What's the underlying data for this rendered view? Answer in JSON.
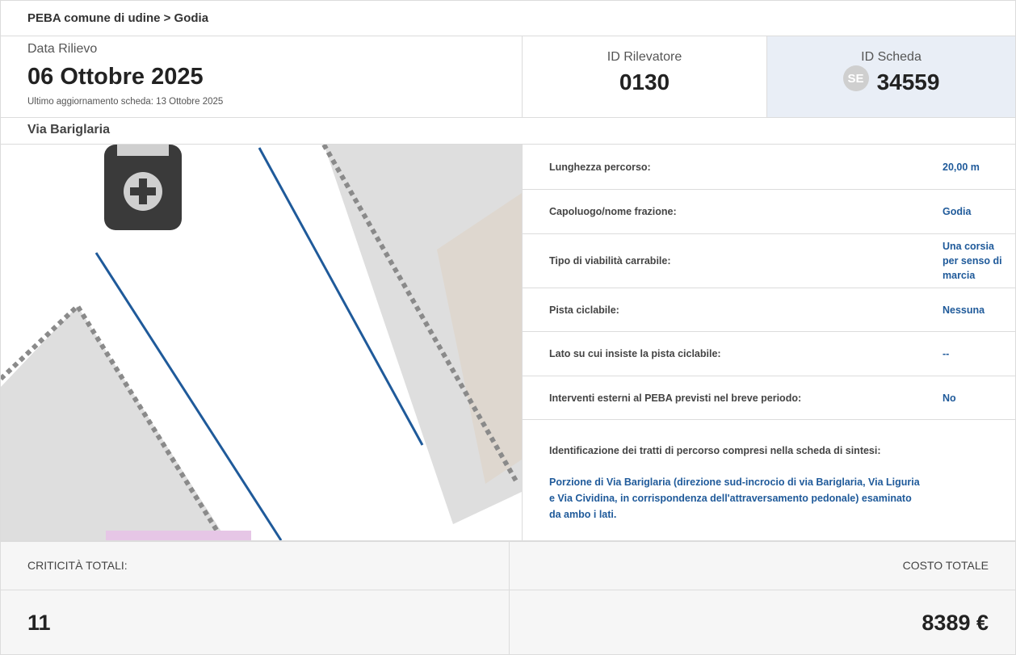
{
  "breadcrumb": "PEBA comune di udine > Godia",
  "header": {
    "date_label": "Data Rilievo",
    "date_value": "06 Ottobre 2025",
    "last_update": "Ultimo aggiornamento scheda: 13 Ottobre 2025",
    "rilevatore_label": "ID Rilevatore",
    "rilevatore_value": "0130",
    "scheda_label": "ID Scheda",
    "scheda_badge": "SE",
    "scheda_value": "34559"
  },
  "street": "Via Bariglaria",
  "map": {
    "icon": "parking-marker-icon",
    "line_color": "#1f5a9a"
  },
  "info": {
    "rows": [
      {
        "label": "Lunghezza percorso:",
        "value": "20,00 m"
      },
      {
        "label": "Capoluogo/nome frazione:",
        "value": "Godia"
      },
      {
        "label": "Tipo di viabilità carrabile:",
        "value": "Una corsia per senso di marcia"
      },
      {
        "label": "Pista ciclabile:",
        "value": "Nessuna"
      },
      {
        "label": "Lato su cui insiste la pista ciclabile:",
        "value": "--"
      },
      {
        "label": "Interventi esterni al PEBA previsti nel breve periodo:",
        "value": "No"
      }
    ],
    "ident_label": "Identificazione dei tratti di percorso compresi nella scheda di sintesi:",
    "ident_value": "Porzione di Via Bariglaria (direzione sud-incrocio di via Bariglaria, Via Liguria e Via Cividina, in corrispondenza dell'attraversamento pedonale) esaminato da ambo i lati."
  },
  "totals": {
    "criticita_label": "CRITICITÀ TOTALI:",
    "criticita_value": "11",
    "costo_label": "COSTO TOTALE",
    "costo_value": "8389 €"
  },
  "colors": {
    "accent": "#1f5a9a",
    "scheda_bg": "#e9eef6",
    "totals_bg": "#f6f6f6"
  }
}
